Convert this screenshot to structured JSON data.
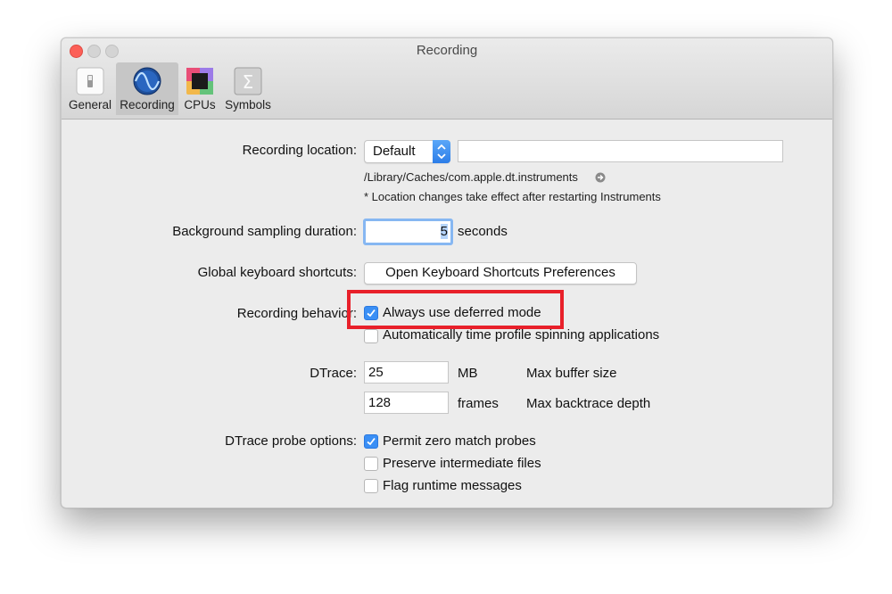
{
  "window": {
    "title": "Recording"
  },
  "tabs": [
    {
      "label": "General",
      "icon": "general-switch-icon"
    },
    {
      "label": "Recording",
      "icon": "waveform-icon",
      "active": true
    },
    {
      "label": "CPUs",
      "icon": "cpu-chip-icon"
    },
    {
      "label": "Symbols",
      "icon": "sigma-icon"
    }
  ],
  "recording_location": {
    "label": "Recording location:",
    "selected": "Default",
    "path_value": "",
    "path": "/Library/Caches/com.apple.dt.instruments",
    "note": "* Location changes take effect after restarting Instruments"
  },
  "background_sampling": {
    "label": "Background sampling duration:",
    "value": "5",
    "unit": "seconds"
  },
  "keyboard_shortcuts": {
    "label": "Global keyboard shortcuts:",
    "button": "Open Keyboard Shortcuts Preferences"
  },
  "recording_behavior": {
    "label": "Recording behavior:",
    "options": [
      {
        "label": "Always use deferred mode",
        "checked": true
      },
      {
        "label": "Automatically time profile spinning applications",
        "checked": false
      }
    ]
  },
  "dtrace": {
    "label": "DTrace:",
    "buffer_value": "25",
    "buffer_unit": "MB",
    "buffer_desc": "Max buffer size",
    "depth_value": "128",
    "depth_unit": "frames",
    "depth_desc": "Max backtrace depth"
  },
  "probe_options": {
    "label": "DTrace probe options:",
    "options": [
      {
        "label": "Permit zero match probes",
        "checked": true
      },
      {
        "label": "Preserve intermediate files",
        "checked": false
      },
      {
        "label": "Flag runtime messages",
        "checked": false
      }
    ]
  },
  "colors": {
    "accent": "#3a8ff5",
    "highlight": "#e8202a"
  }
}
